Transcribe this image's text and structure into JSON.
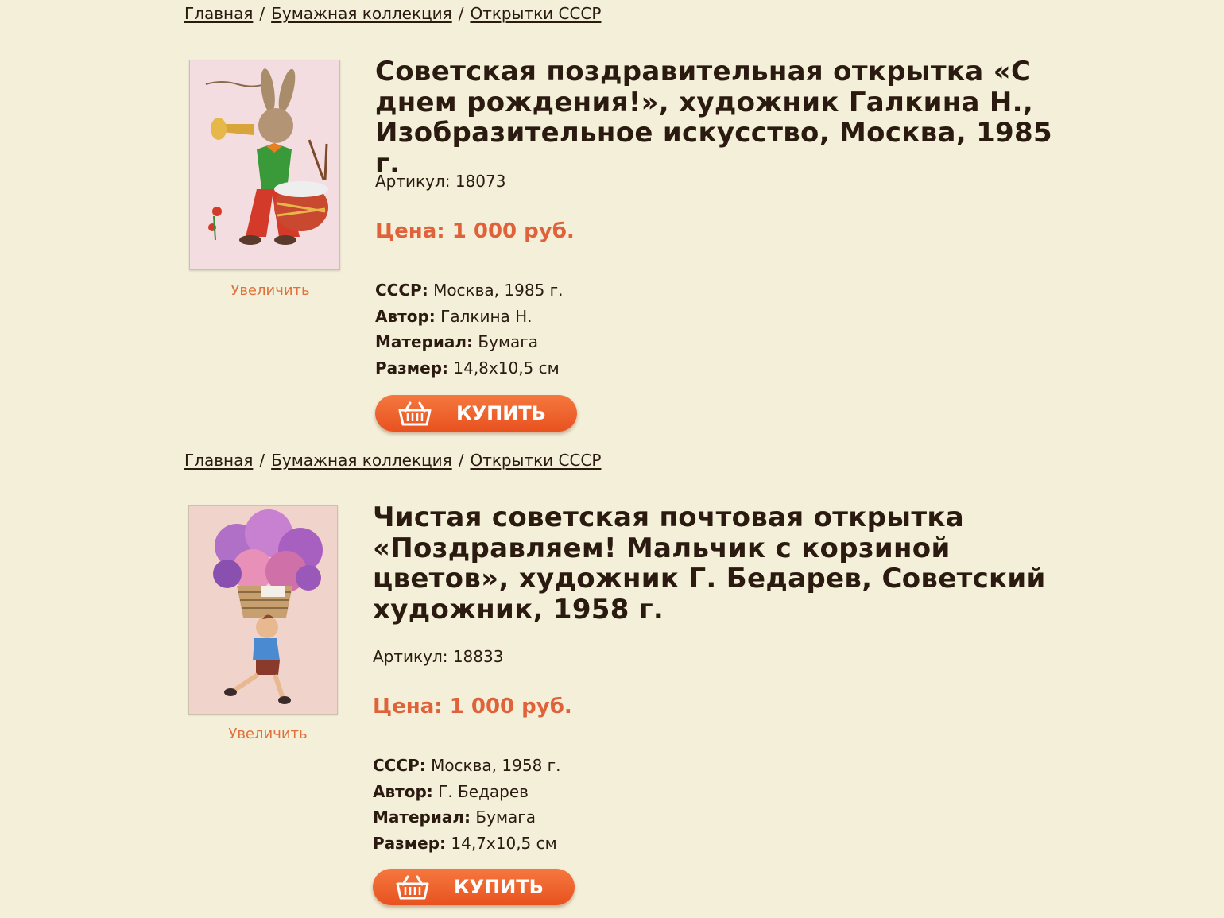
{
  "products": [
    {
      "breadcrumb": [
        "Главная",
        "Бумажная коллекция",
        "Открытки СССР"
      ],
      "title": "Советская поздравительная открытка «С днем рождения!», художник Галкина Н., Изобразительное искусство, Москва, 1985 г.",
      "sku_label": "Артикул:",
      "sku_value": "18073",
      "price": "Цена: 1 000 руб.",
      "zoom_label": "Увеличить",
      "specs": [
        {
          "label": "СССР:",
          "value": "Москва, 1985 г."
        },
        {
          "label": "Автор:",
          "value": "Галкина Н."
        },
        {
          "label": "Материал:",
          "value": "Бумага"
        },
        {
          "label": "Размер:",
          "value": "14,8х10,5 см"
        }
      ],
      "buy_label": "КУПИТЬ"
    },
    {
      "breadcrumb": [
        "Главная",
        "Бумажная коллекция",
        "Открытки СССР"
      ],
      "title": "Чистая советская почтовая открытка «Поздравляем! Мальчик с корзиной цветов», художник Г. Бедарев, Советский художник, 1958 г.",
      "sku_label": "Артикул:",
      "sku_value": "18833",
      "price": "Цена: 1 000 руб.",
      "zoom_label": "Увеличить",
      "specs": [
        {
          "label": "СССР:",
          "value": "Москва, 1958 г."
        },
        {
          "label": "Автор:",
          "value": "Г. Бедарев"
        },
        {
          "label": "Материал:",
          "value": "Бумага"
        },
        {
          "label": "Размер:",
          "value": "14,7х10,5 см"
        }
      ],
      "buy_label": "КУПИТЬ"
    }
  ],
  "colors": {
    "background": "#f3efd9",
    "accent": "#e0623a",
    "text": "#2a1a10"
  },
  "icons": {
    "buy_button": "basket-icon"
  }
}
